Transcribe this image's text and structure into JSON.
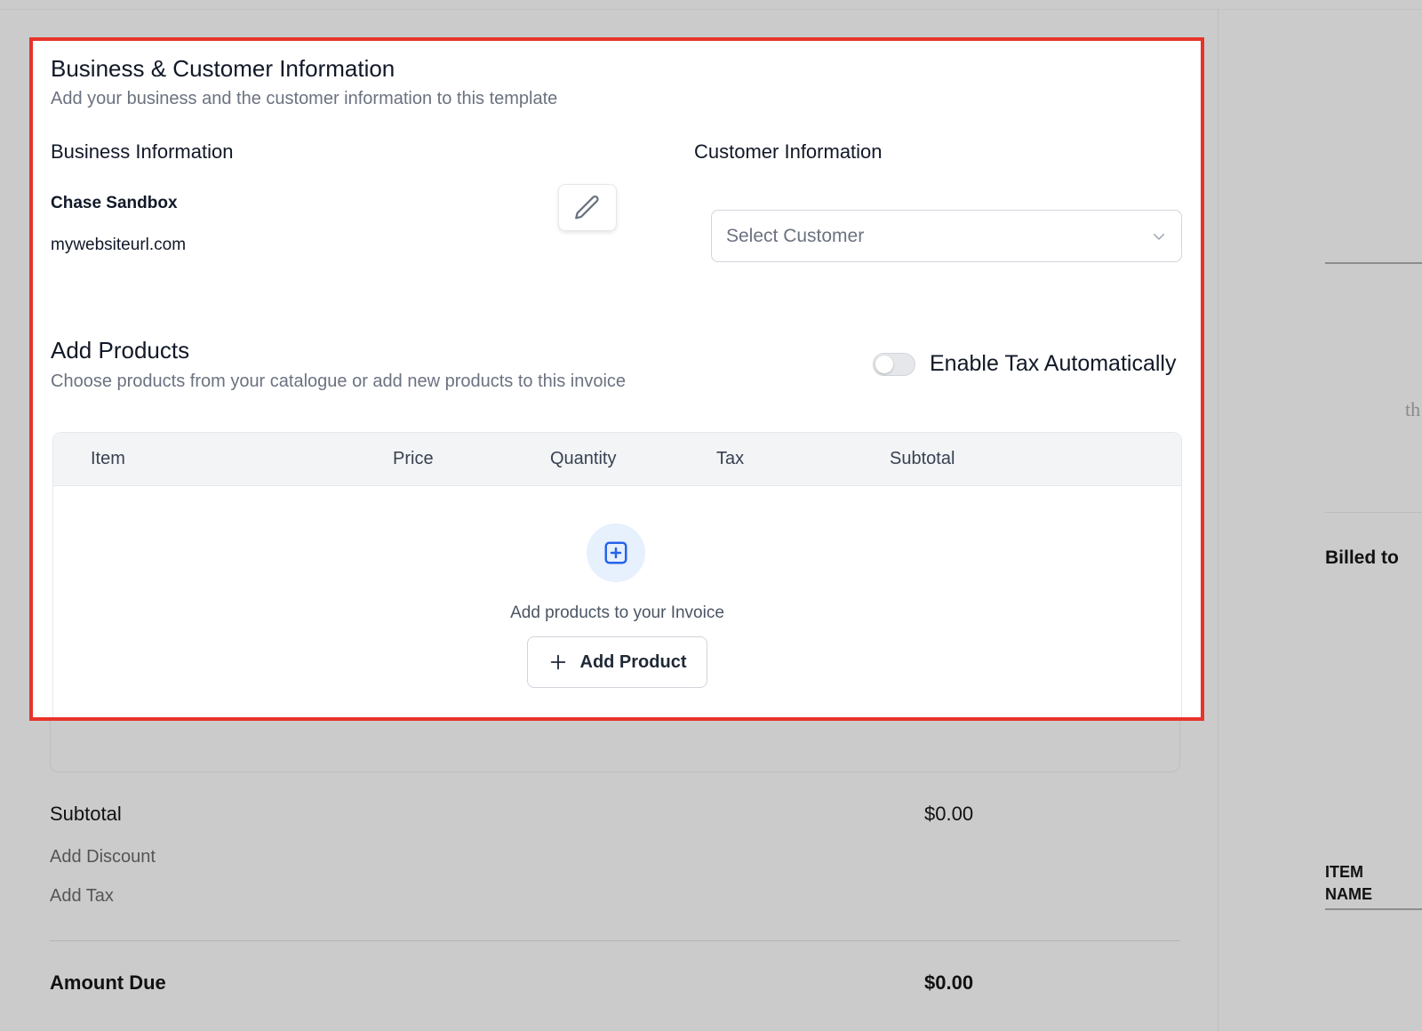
{
  "business_customer": {
    "title": "Business & Customer Information",
    "subtitle": "Add your business and the customer information to this template"
  },
  "business": {
    "heading": "Business Information",
    "name": "Chase Sandbox",
    "url": "mywebsiteurl.com"
  },
  "customer": {
    "heading": "Customer Information",
    "select_placeholder": "Select Customer"
  },
  "products": {
    "title": "Add Products",
    "subtitle": "Choose products from your catalogue or add new products to this invoice",
    "tax_toggle_label": "Enable Tax Automatically",
    "tax_enabled": false,
    "columns": [
      "Item",
      "Price",
      "Quantity",
      "Tax",
      "Subtotal"
    ],
    "empty_text": "Add products to your Invoice",
    "add_button_label": "Add Product"
  },
  "summary": {
    "subtotal_label": "Subtotal",
    "subtotal_value": "$0.00",
    "add_discount": "Add Discount",
    "add_tax": "Add Tax",
    "amount_due_label": "Amount Due",
    "amount_due_value": "$0.00"
  },
  "preview": {
    "peek_text": "th",
    "billed_to": "Billed to",
    "item_name": "ITEM NAME"
  },
  "colors": {
    "highlight_border": "#e7332a",
    "accent_blue": "#2563eb",
    "background": "#cbcbcb"
  }
}
